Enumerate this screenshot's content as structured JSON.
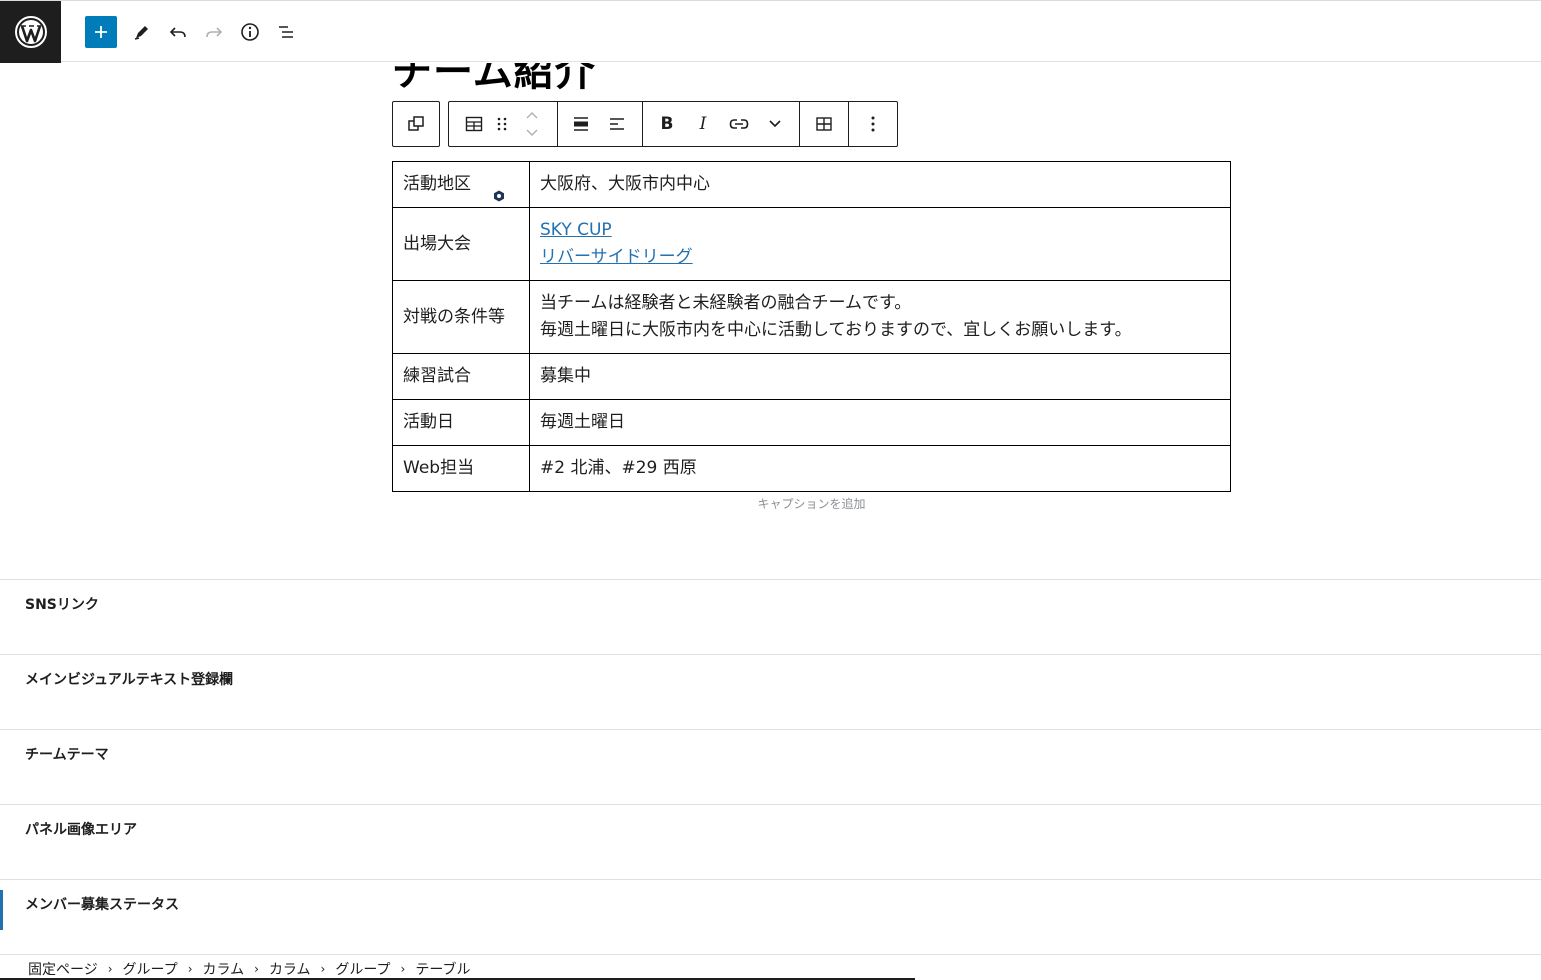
{
  "topbar": {
    "logo_icon": "wordpress-icon",
    "tools": [
      "add-block-icon",
      "pen-tool-icon",
      "undo-icon",
      "redo-icon",
      "info-icon",
      "list-view-icon"
    ]
  },
  "page_title": "チーム紹介",
  "block_toolbar": {
    "icons": [
      "transform-icon",
      "table-icon",
      "drag-handle-icon",
      "move-up-down-icon",
      "align-wide-icon",
      "align-left-icon",
      "bold-icon",
      "italic-icon",
      "link-icon",
      "more-formats-chevron-icon",
      "edit-table-icon",
      "options-icon"
    ],
    "bold_label": "B",
    "italic_label": "I"
  },
  "table": {
    "rows": [
      {
        "label": "活動地区",
        "lines": [
          "大阪府、大阪市内中心"
        ]
      },
      {
        "label": "出場大会",
        "links": [
          "SKY CUP",
          "リバーサイドリーグ"
        ]
      },
      {
        "label": "対戦の条件等",
        "lines": [
          "当チームは経験者と未経験者の融合チームです。",
          "毎週土曜日に大阪市内を中心に活動しておりますので、宜しくお願いします。"
        ]
      },
      {
        "label": "練習試合",
        "lines": [
          "募集中"
        ]
      },
      {
        "label": "活動日",
        "lines": [
          "毎週土曜日"
        ]
      },
      {
        "label": "Web担当",
        "lines": [
          "#2 北浦、#29 西原"
        ]
      }
    ],
    "caption_placeholder": "キャプションを追加"
  },
  "meta_boxes": [
    "SNSリンク",
    "メインビジュアルテキスト登録欄",
    "チームテーマ",
    "パネル画像エリア",
    "メンバー募集ステータス"
  ],
  "breadcrumbs": [
    "固定ページ",
    "グループ",
    "カラム",
    "カラム",
    "グループ",
    "テーブル"
  ],
  "colors": {
    "accent": "#007cba",
    "link": "#2271b1",
    "dark": "#1e1e1e"
  }
}
